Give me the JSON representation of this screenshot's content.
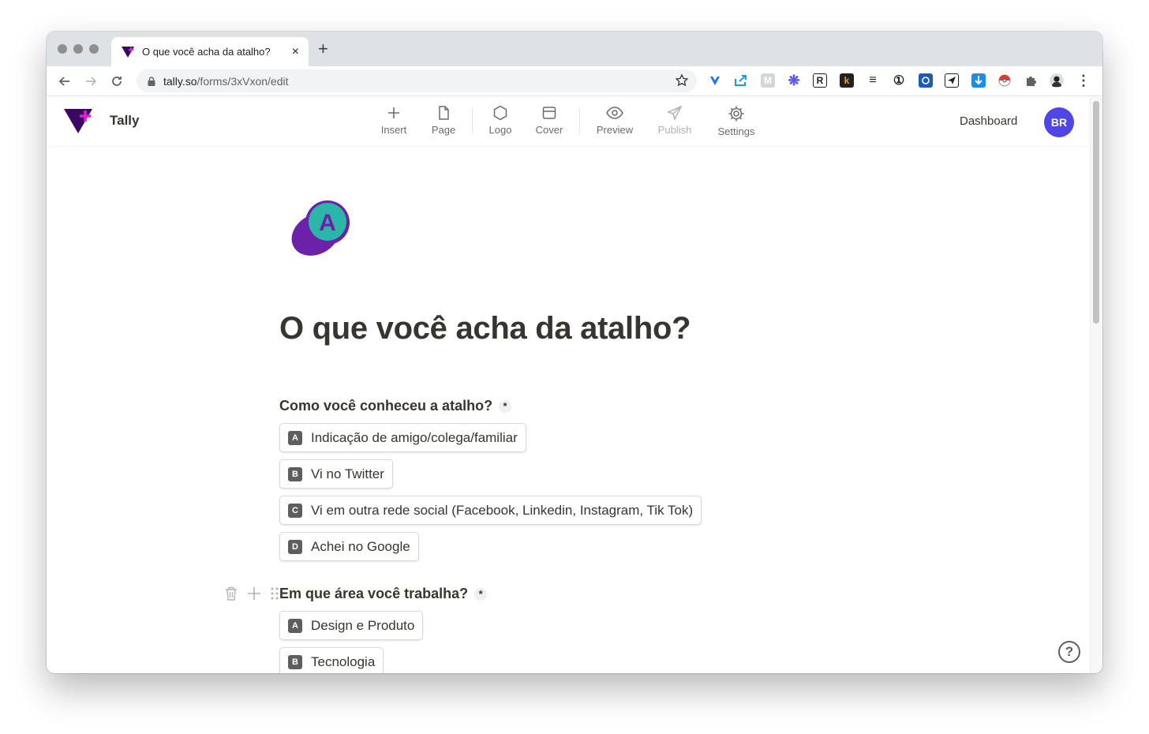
{
  "browser": {
    "tab_title": "O que você acha da atalho?",
    "tab_close": "×",
    "new_tab": "+",
    "url_host": "tally.so",
    "url_path": "/forms/3xVxon/edit"
  },
  "extensions": [
    "R",
    "k",
    "≡",
    "①"
  ],
  "app": {
    "brand": "Tally",
    "toolbar": [
      {
        "label": "Insert",
        "icon": "plus-icon"
      },
      {
        "label": "Page",
        "icon": "page-icon"
      },
      {
        "label": "Logo",
        "icon": "hexagon-icon"
      },
      {
        "label": "Cover",
        "icon": "cover-icon"
      },
      {
        "label": "Preview",
        "icon": "eye-icon"
      },
      {
        "label": "Publish",
        "icon": "send-icon",
        "disabled": true
      },
      {
        "label": "Settings",
        "icon": "gear-icon"
      }
    ],
    "dashboard": "Dashboard",
    "avatar": "BR",
    "accent": "#4f46e5"
  },
  "form": {
    "logo_letter": "A",
    "title": "O que você acha da atalho?",
    "required_mark": "*",
    "questions": [
      {
        "label": "Como você conheceu a atalho?",
        "options": [
          {
            "key": "A",
            "label": "Indicação de amigo/colega/familiar"
          },
          {
            "key": "B",
            "label": "Vi no Twitter"
          },
          {
            "key": "C",
            "label": "Vi em outra rede social (Facebook, Linkedin, Instagram, Tik Tok)"
          },
          {
            "key": "D",
            "label": "Achei no Google"
          }
        ]
      },
      {
        "label": "Em que área você trabalha?",
        "options": [
          {
            "key": "A",
            "label": "Design e Produto"
          },
          {
            "key": "B",
            "label": "Tecnologia"
          }
        ]
      }
    ]
  },
  "help": "?"
}
